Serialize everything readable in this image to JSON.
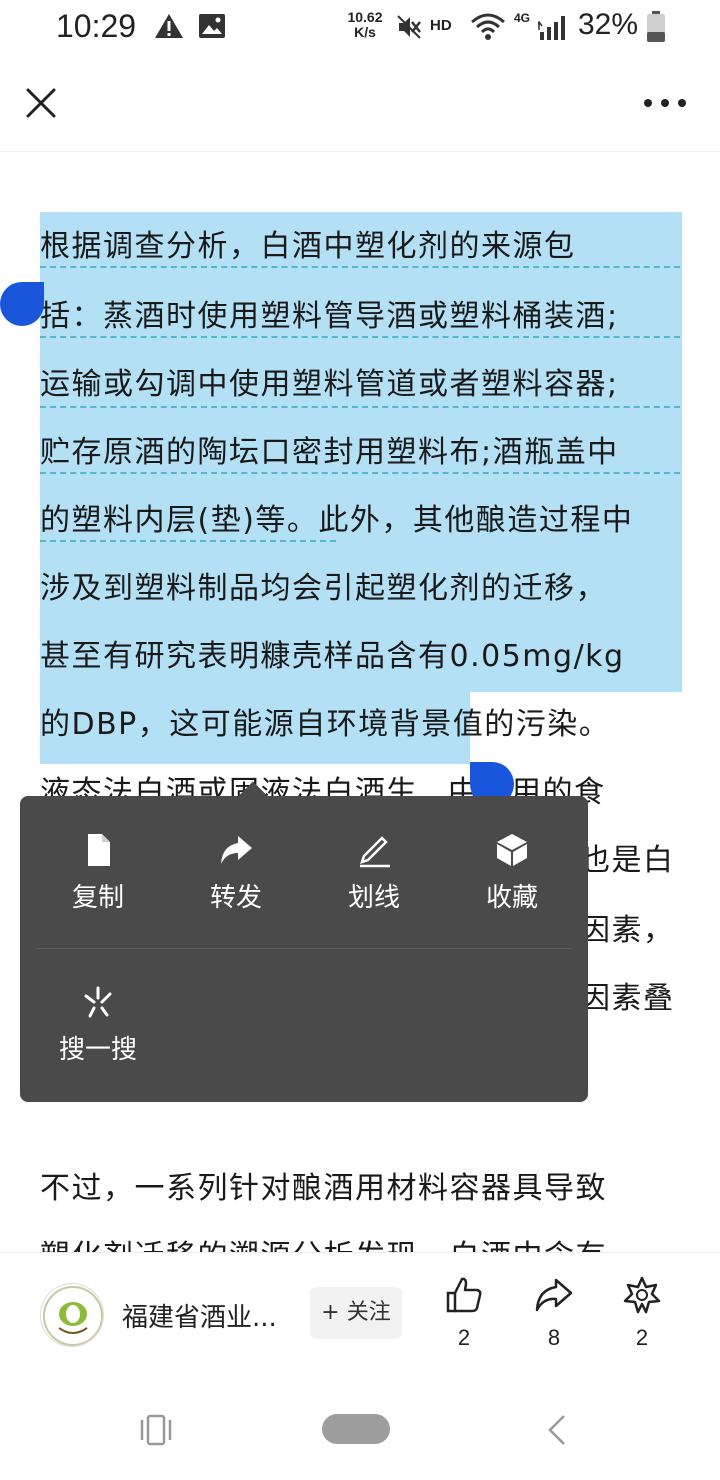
{
  "status_bar": {
    "time": "10:29",
    "network_speed_value": "10.62",
    "network_speed_unit": "K/s",
    "hd_label": "HD",
    "network_type": "4G",
    "battery_percent": "32%",
    "icons": [
      "warning-icon",
      "image-icon",
      "mute-icon",
      "wifi-icon",
      "signal-icon",
      "battery-icon"
    ]
  },
  "top_bar": {
    "close_icon": "close-icon",
    "more_icon": "more-icon"
  },
  "article": {
    "paragraph1_lines": [
      "根据调查分析，白酒中塑化剂的来源包",
      "括：蒸酒时使用塑料管导酒或塑料桶装酒;",
      "运输或勾调中使用塑料管道或者塑料容器;",
      "贮存原酒的陶坛口密封用塑料布;酒瓶盖中",
      "的塑料内层(垫)等。此外，其他酿造过程中",
      "涉及到塑料制品均会引起塑化剂的迁移，",
      "甚至有研究表明糠壳样品含有0.05mg/kg"
    ],
    "last_line_selected": "的DBP，这可能源自环境背",
    "last_line_rest": "景值的污染。",
    "hidden_line_fragment": "液态法白酒或固液法白酒生",
    "hidden_line_tail": "中使用的食",
    "right_fragments": [
      "也是白",
      "因素，",
      "因素叠"
    ],
    "paragraph2_lines": [
      "不过，一系列针对酿酒用材料容器具导致",
      "塑化剂迁移的溯源分析发现，白酒中含有"
    ],
    "highlight_color": "#b3e0f5"
  },
  "selection_menu": {
    "items": [
      {
        "label": "复制",
        "icon": "copy-icon"
      },
      {
        "label": "转发",
        "icon": "forward-icon"
      },
      {
        "label": "划线",
        "icon": "underline-pen-icon"
      },
      {
        "label": "收藏",
        "icon": "favorite-box-icon"
      }
    ],
    "search": {
      "label": "搜一搜",
      "icon": "search-sparkle-icon"
    }
  },
  "bottom_bar": {
    "author_name": "福建省酒业...",
    "follow_label": "+ 关注",
    "like_count": "2",
    "share_count": "8",
    "wow_count": "2"
  },
  "nav_bar": {
    "icons": [
      "recents-icon",
      "home-pill",
      "back-icon"
    ]
  },
  "colors": {
    "selection_handle": "#1a56db",
    "menu_background": "#4a4a4a"
  }
}
